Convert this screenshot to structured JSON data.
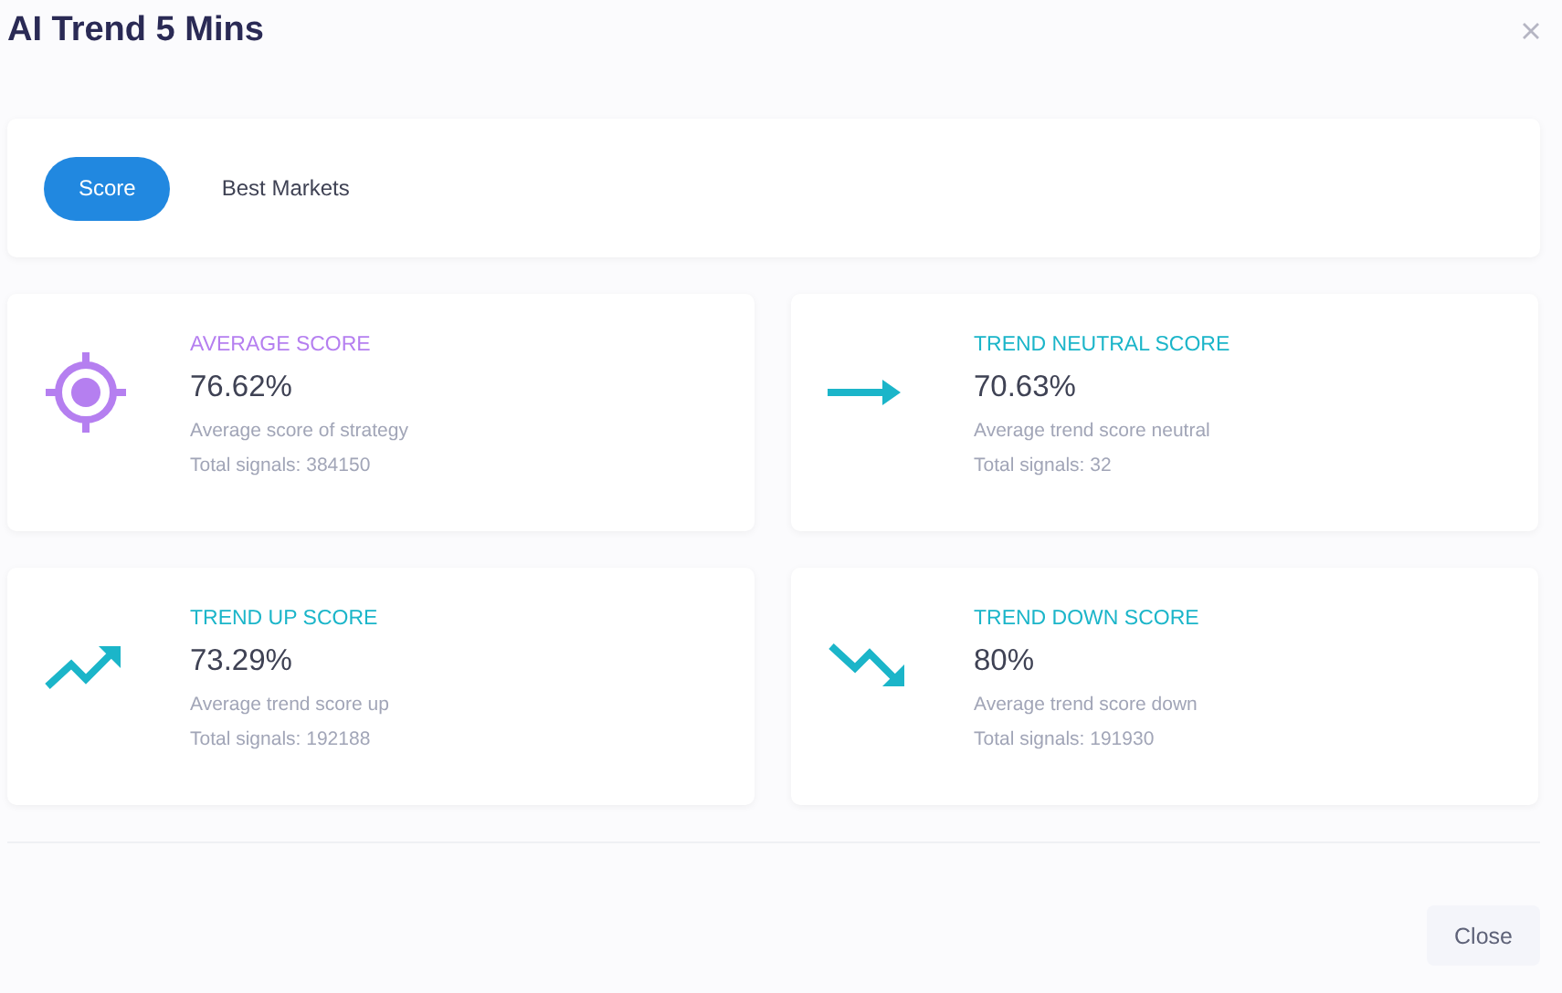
{
  "window": {
    "title": "AI Trend 5 Mins"
  },
  "tabs": [
    {
      "label": "Score",
      "selected": true
    },
    {
      "label": "Best Markets",
      "selected": false
    }
  ],
  "cards": [
    {
      "kind": "target",
      "color": "#b57ff0",
      "title": "AVERAGE SCORE",
      "value": "76.62%",
      "description": "Average score of strategy",
      "signals": "Total signals: 384150"
    },
    {
      "kind": "right",
      "color": "#1bb5c9",
      "title": "TREND NEUTRAL SCORE",
      "value": "70.63%",
      "description": "Average trend score neutral",
      "signals": "Total signals: 32"
    },
    {
      "kind": "up",
      "color": "#1bb5c9",
      "title": "TREND UP SCORE",
      "value": "73.29%",
      "description": "Average trend score up",
      "signals": "Total signals: 192188"
    },
    {
      "kind": "down",
      "color": "#1bb5c9",
      "title": "TREND DOWN SCORE",
      "value": "80%",
      "description": "Average trend score down",
      "signals": "Total signals: 191930"
    }
  ],
  "buttons": [
    "Close"
  ]
}
